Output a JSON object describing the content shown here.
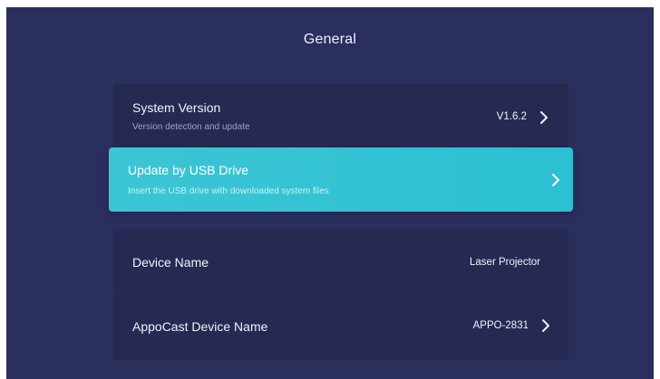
{
  "page": {
    "title": "General"
  },
  "items": {
    "system_version": {
      "title": "System Version",
      "subtitle": "Version detection and update",
      "value": "V1.6.2"
    },
    "usb_update": {
      "title": "Update by USB Drive",
      "subtitle": "Insert the USB drive with downloaded system files"
    },
    "device_name": {
      "title": "Device Name",
      "value": "Laser Projector"
    },
    "appocast_name": {
      "title": "AppoCast Device Name",
      "value": "APPO-2831"
    }
  },
  "icons": {
    "chevron": "chevron-right-icon"
  },
  "colors": {
    "background": "#2b2f5e",
    "card": "#262a52",
    "highlight": "#2bc0d2",
    "text": "#f1f2fa",
    "subtext": "#9ea2c5"
  }
}
